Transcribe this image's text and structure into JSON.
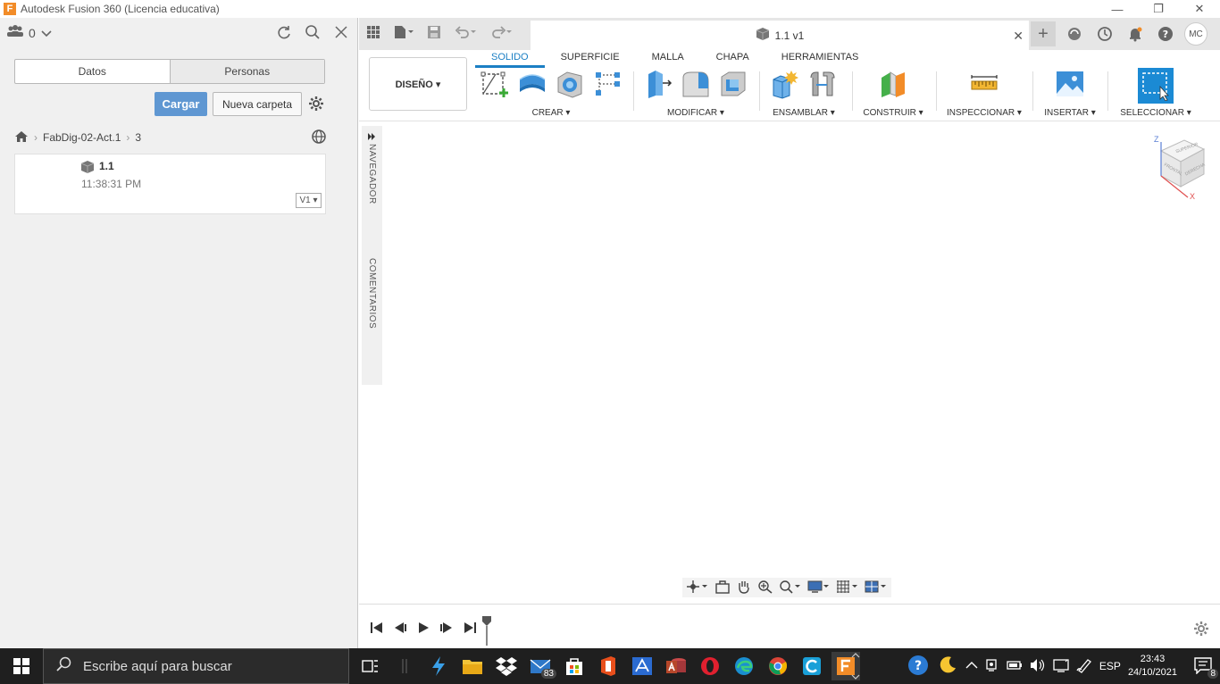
{
  "window": {
    "title": "Autodesk Fusion 360 (Licencia educativa)",
    "logo_letter": "F"
  },
  "data_panel": {
    "team_count": "0",
    "tabs": [
      "Datos",
      "Personas"
    ],
    "upload_label": "Cargar",
    "new_folder_label": "Nueva carpeta",
    "breadcrumb": [
      "FabDig-02-Act.1",
      "3"
    ],
    "file": {
      "name": "1.1",
      "time": "11:38:31 PM",
      "version": "V1 ▾"
    }
  },
  "document": {
    "tab_title": "1.1 v1",
    "user_initials": "MC"
  },
  "toolbar": {
    "workspace": "DISEÑO ▾",
    "tabs": [
      "SOLIDO",
      "SUPERFICIE",
      "MALLA",
      "CHAPA",
      "HERRAMIENTAS"
    ],
    "groups": {
      "crear": "CREAR ▾",
      "modificar": "MODIFICAR ▾",
      "ensamblar": "ENSAMBLAR ▾",
      "construir": "CONSTRUIR ▾",
      "inspeccionar": "INSPECCIONAR ▾",
      "insertar": "INSERTAR ▾",
      "seleccionar": "SELECCIONAR ▾"
    }
  },
  "viewport": {
    "browser_label": "NAVEGADOR",
    "comments_label": "COMENTARIOS",
    "viewcube": {
      "front": "FRONTAL",
      "right": "DERECHA",
      "top": "SUPERIOR",
      "axis_z": "Z",
      "axis_x": "X"
    }
  },
  "taskbar": {
    "search_placeholder": "Escribe aquí para buscar",
    "mail_badge": "83",
    "language": "ESP",
    "time": "23:43",
    "date": "24/10/2021",
    "notifications": "8"
  },
  "colors": {
    "accent": "#1b7fc4",
    "upload_button": "#5f97d2",
    "taskbar": "#1f1f1f"
  }
}
